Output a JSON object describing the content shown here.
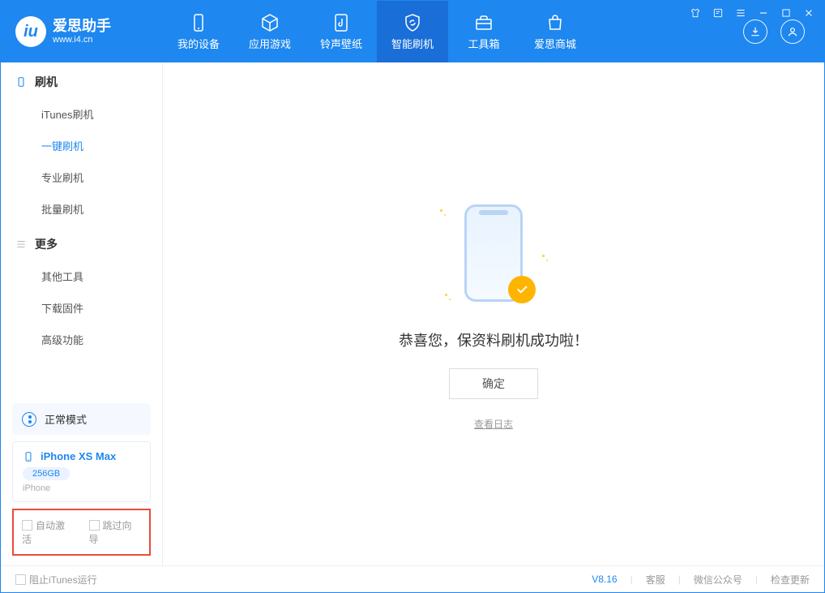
{
  "app": {
    "name": "爱思助手",
    "url": "www.i4.cn",
    "version": "V8.16"
  },
  "nav": {
    "device": "我的设备",
    "apps": "应用游戏",
    "ringtone": "铃声壁纸",
    "flash": "智能刷机",
    "toolbox": "工具箱",
    "store": "爱思商城"
  },
  "sidebar": {
    "cat_flash": "刷机",
    "items_flash": [
      "iTunes刷机",
      "一键刷机",
      "专业刷机",
      "批量刷机"
    ],
    "cat_more": "更多",
    "items_more": [
      "其他工具",
      "下载固件",
      "高级功能"
    ]
  },
  "mode": {
    "label": "正常模式"
  },
  "device": {
    "name": "iPhone XS Max",
    "capacity": "256GB",
    "type": "iPhone"
  },
  "options": {
    "auto_activate": "自动激活",
    "skip_guide": "跳过向导"
  },
  "main": {
    "success_msg": "恭喜您，保资料刷机成功啦！",
    "ok": "确定",
    "view_log": "查看日志"
  },
  "footer": {
    "block_itunes": "阻止iTunes运行",
    "service": "客服",
    "wechat": "微信公众号",
    "update": "检查更新"
  }
}
